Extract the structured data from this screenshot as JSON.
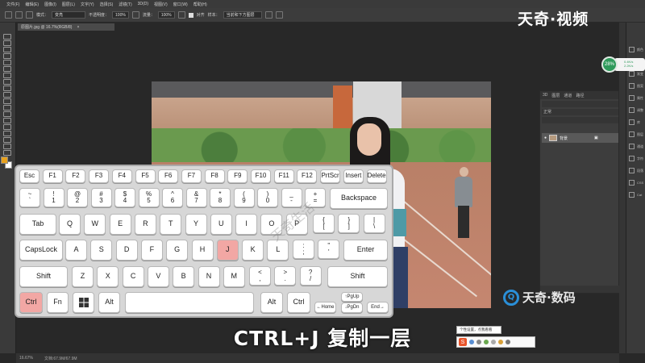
{
  "app": {
    "menu": [
      "文件(F)",
      "编辑(E)",
      "图像(I)",
      "图层(L)",
      "文字(Y)",
      "选择(S)",
      "滤镜(T)",
      "3D(D)",
      "视图(V)",
      "窗口(W)",
      "帮助(H)"
    ],
    "options": {
      "mode_label": "模式：",
      "mode_value": "变亮",
      "opacity_label": "不透明度：",
      "opacity_value": "100%",
      "flow_label": "流量：",
      "flow_value": "100%",
      "align_label": "对齐",
      "sample_label": "样本：",
      "sample_value": "当前和下方图层"
    },
    "document_tab": "原图片.jpg @ 16.7%(RGB/8)",
    "status_zoom": "16.67%",
    "status_doc": "文档:67.9M/67.9M"
  },
  "panels": {
    "tabs": [
      "3D",
      "图层",
      "通道",
      "路径"
    ],
    "kind_label": "正常",
    "layer_name": "背景",
    "right_labels": [
      "颜色",
      "色板",
      "渐变",
      "图案",
      "属性",
      "调整",
      "库",
      "图层",
      "通道",
      "字符",
      "段落",
      "CSS",
      "Cat"
    ]
  },
  "cpu_widget": {
    "percent": "28%",
    "up": "0.4K/s",
    "down": "2.2K/s",
    "accent": "#2f9a5b"
  },
  "keyboard": {
    "highlight_color": "#f2a7a4",
    "row_function": [
      "Esc",
      "F1",
      "F2",
      "F3",
      "F4",
      "F5",
      "F6",
      "F7",
      "F8",
      "F9",
      "F10",
      "F11",
      "F12",
      "PrtScr",
      "Insert",
      "Delete"
    ],
    "row_number": [
      {
        "top": "~",
        "bottom": "`"
      },
      {
        "top": "!",
        "bottom": "1"
      },
      {
        "top": "@",
        "bottom": "2"
      },
      {
        "top": "#",
        "bottom": "3"
      },
      {
        "top": "$",
        "bottom": "4"
      },
      {
        "top": "%",
        "bottom": "5"
      },
      {
        "top": "^",
        "bottom": "6"
      },
      {
        "top": "&",
        "bottom": "7"
      },
      {
        "top": "*",
        "bottom": "8"
      },
      {
        "top": "(",
        "bottom": "9"
      },
      {
        "top": ")",
        "bottom": "0"
      },
      {
        "top": "_",
        "bottom": "-"
      },
      {
        "top": "+",
        "bottom": "="
      }
    ],
    "backspace": "Backspace",
    "tab": "Tab",
    "row_q": [
      "Q",
      "W",
      "E",
      "R",
      "T",
      "Y",
      "U",
      "I",
      "O",
      "P"
    ],
    "row_q_sym": [
      {
        "top": "{",
        "bottom": "["
      },
      {
        "top": "}",
        "bottom": "]"
      },
      {
        "top": "|",
        "bottom": "\\"
      }
    ],
    "capslock": "CapsLock",
    "row_a": [
      "A",
      "S",
      "D",
      "F",
      "G",
      "H",
      "J",
      "K",
      "L"
    ],
    "row_a_sym": [
      {
        "top": ":",
        "bottom": ";"
      },
      {
        "top": "\"",
        "bottom": "'"
      }
    ],
    "enter": "Enter",
    "shift": "Shift",
    "row_z": [
      "Z",
      "X",
      "C",
      "V",
      "B",
      "N",
      "M"
    ],
    "row_z_sym": [
      {
        "top": "<",
        "bottom": ","
      },
      {
        "top": ">",
        "bottom": "."
      },
      {
        "top": "?",
        "bottom": "/"
      }
    ],
    "ctrl": "Ctrl",
    "fn": "Fn",
    "alt": "Alt",
    "pgup": "↑PgUp",
    "pgdn": "↓PgDn",
    "home": "←Home",
    "end": "End→",
    "pressed": [
      "Ctrl",
      "J"
    ]
  },
  "branding": {
    "top": "天奇·视频",
    "bottom": "天奇·数码",
    "bottom_mark": "Q",
    "watermark": "天奇生活",
    "accent": "#2a8fd8"
  },
  "subtitle": "CTRL+J 复制一层",
  "ime": {
    "tip": "个性设置，点我看看",
    "logo": "S"
  }
}
